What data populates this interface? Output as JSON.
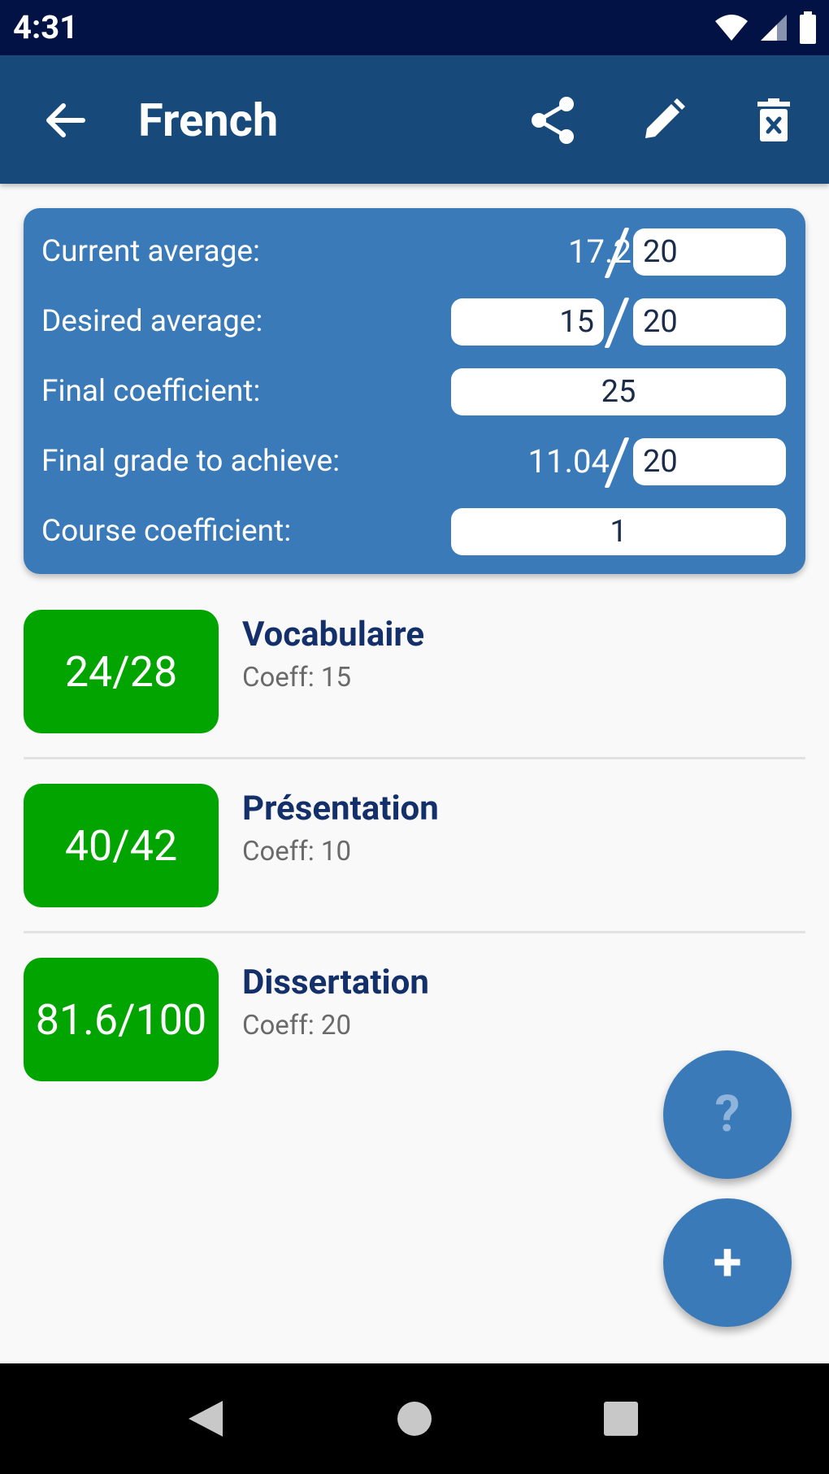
{
  "status_bar": {
    "time": "4:31"
  },
  "app_bar": {
    "title": "French"
  },
  "summary": {
    "current_average": {
      "label": "Current average:",
      "value": "17.2",
      "scale": "20"
    },
    "desired_average": {
      "label": "Desired average:",
      "value": "15",
      "scale": "20"
    },
    "final_coefficient": {
      "label": "Final coefficient:",
      "value": "25"
    },
    "final_grade": {
      "label": "Final grade to achieve:",
      "value": "11.04",
      "scale": "20"
    },
    "course_coefficient": {
      "label": "Course coefficient:",
      "value": "1"
    }
  },
  "grades": [
    {
      "score": "24/28",
      "name": "Vocabulaire",
      "coeff": "Coeff: 15"
    },
    {
      "score": "40/42",
      "name": "Présentation",
      "coeff": "Coeff: 10"
    },
    {
      "score": "81.6/100",
      "name": "Dissertation",
      "coeff": "Coeff: 20"
    }
  ],
  "fabs": {
    "help": "?",
    "add": "+"
  },
  "colors": {
    "status_bar": "#021245",
    "app_bar": "#174a7a",
    "card": "#3a7ab9",
    "grade_badge": "#02a500",
    "grade_name": "#14306a"
  },
  "icons": {
    "back": "arrow-left-icon",
    "share": "share-icon",
    "edit": "pencil-icon",
    "delete": "delete-icon"
  }
}
